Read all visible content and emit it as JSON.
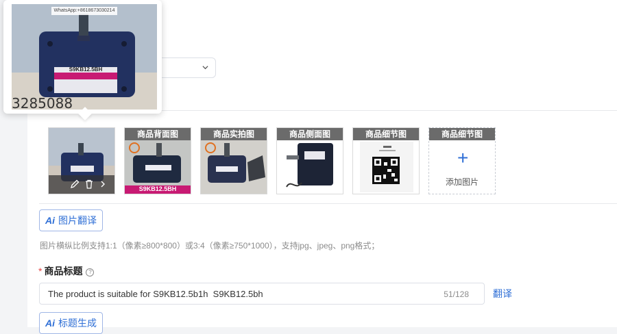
{
  "images": [
    {
      "caption": "",
      "name": "main",
      "bar_icons": [
        "edit-icon",
        "delete-icon",
        "chevron-right-icon"
      ]
    },
    {
      "caption": "商品背面图",
      "name": "back",
      "tag": "S9KB12.5BH"
    },
    {
      "caption": "商品实拍图",
      "name": "real"
    },
    {
      "caption": "商品侧面图",
      "name": "side"
    },
    {
      "caption": "商品细节图",
      "name": "detail"
    },
    {
      "caption": "商品细节图",
      "name": "add",
      "add_label": "添加图片"
    }
  ],
  "ai_translate_button": {
    "ai": "Ai",
    "label": "图片翻译"
  },
  "hint": "图片横纵比例支持1:1（像素≥800*800）或3:4（像素≥750*1000），支持jpg、jpeg、png格式；",
  "title_field": {
    "required_mark": "*",
    "label": "商品标题",
    "help": "?",
    "value": "The product is suitable for S9KB12.5b1h  S9KB12.5bh",
    "counter": "51/128",
    "translate_link": "翻译"
  },
  "ai_title_button": {
    "ai": "Ai",
    "label": "标题生成"
  },
  "preview": {
    "watermark": "WhatsApp:+8618673030214",
    "motor_label": "S9KB12.5BH",
    "bg_digits": "3285088"
  },
  "colors": {
    "accent": "#2f6fd6",
    "required": "#e54545",
    "motor": "#223160",
    "tag": "#c81a73"
  }
}
